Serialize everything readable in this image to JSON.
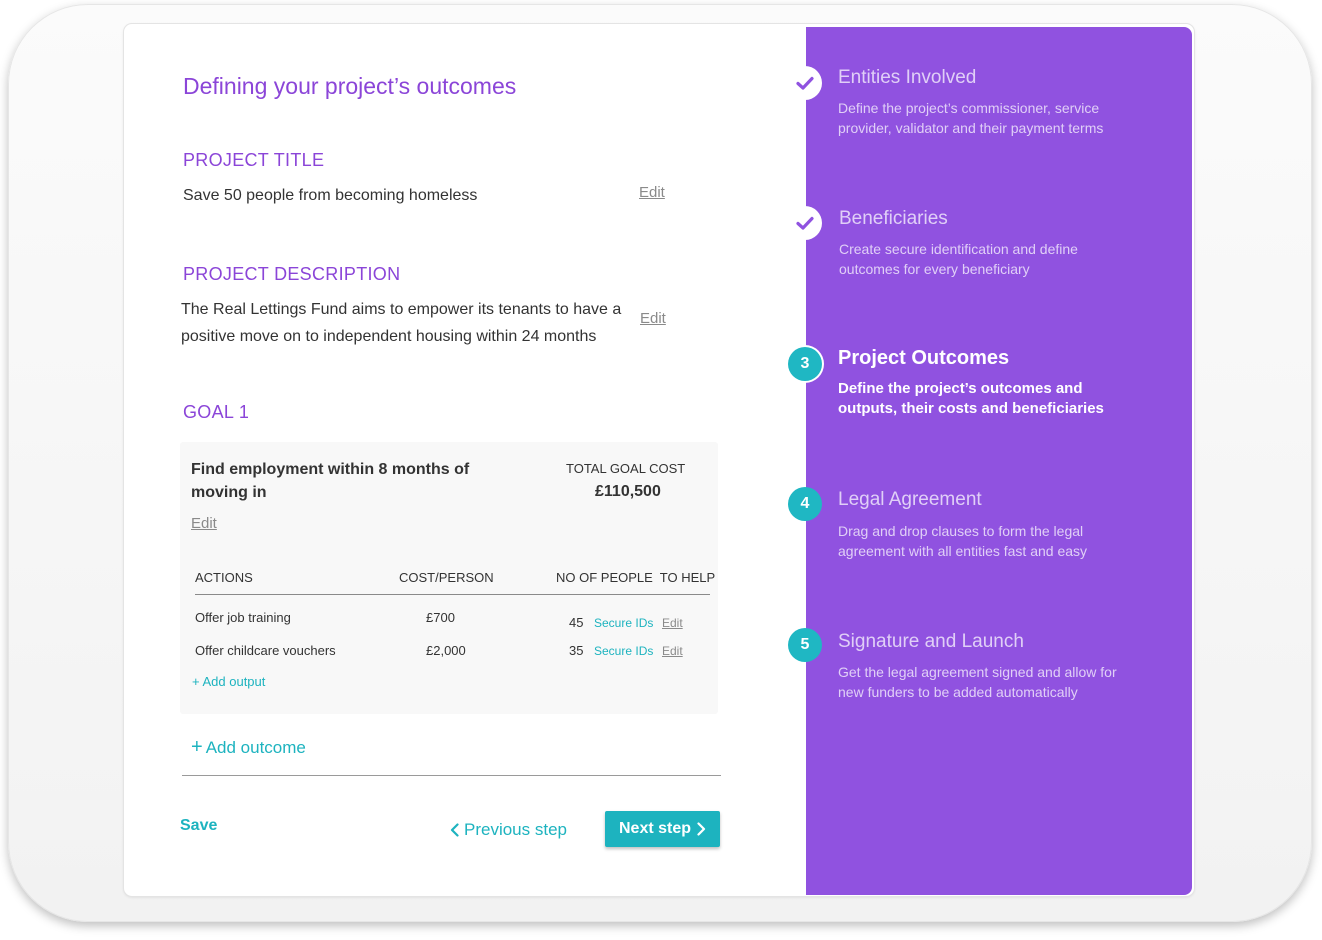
{
  "page_title": "Defining your project’s outcomes",
  "project_title": {
    "heading": "PROJECT TITLE",
    "value": "Save 50 people from becoming homeless",
    "edit_label": "Edit"
  },
  "project_description": {
    "heading": "PROJECT DESCRIPTION",
    "line1": "The Real Lettings Fund aims to empower its tenants to have a",
    "line2": "positive move on to independent housing within 24 months",
    "edit_label": "Edit"
  },
  "goal": {
    "heading": "GOAL 1",
    "title_line1": "Find employment within 8 months of",
    "title_line2": "moving in",
    "edit_label": "Edit",
    "total_cost_label": "TOTAL GOAL COST",
    "total_cost_value": "£110,500",
    "columns": [
      "ACTIONS",
      "COST/PERSON",
      "NO OF PEOPLE  TO HELP"
    ],
    "rows": [
      {
        "action": "Offer job training",
        "cost": "£700",
        "people": "45",
        "secure_ids": "Secure IDs",
        "edit": "Edit"
      },
      {
        "action": "Offer childcare vouchers",
        "cost": "£2,000",
        "people": "35",
        "secure_ids": "Secure IDs",
        "edit": "Edit"
      }
    ],
    "add_output": "+ Add output"
  },
  "add_outcome": {
    "plus": "+",
    "label": "Add outcome"
  },
  "footer": {
    "save": "Save",
    "previous": "Previous step",
    "next": "Next step"
  },
  "steps": [
    {
      "marker": "check",
      "title": "Entities Involved",
      "desc_line1": "Define the project’s commissioner, service",
      "desc_line2": "provider, validator and their payment terms",
      "active": false
    },
    {
      "marker": "check",
      "title": "Beneficiaries",
      "desc_line1": "Create secure identification and define",
      "desc_line2": "outcomes for every beneficiary",
      "active": false
    },
    {
      "marker": "3",
      "title": "Project Outcomes",
      "desc_line1": "Define the project’s outcomes and",
      "desc_line2": "outputs, their costs and beneficiaries",
      "active": true
    },
    {
      "marker": "4",
      "title": "Legal Agreement",
      "desc_line1": "Drag and drop clauses to form the legal",
      "desc_line2": "agreement with all entities fast and easy",
      "active": false
    },
    {
      "marker": "5",
      "title": "Signature and Launch",
      "desc_line1": "Get the legal agreement signed and allow for",
      "desc_line2": "new funders to be added automatically",
      "active": false
    }
  ],
  "colors": {
    "accent_purple": "#8b45d8",
    "sidebar_purple": "#9052e0",
    "teal": "#1db3bf"
  }
}
